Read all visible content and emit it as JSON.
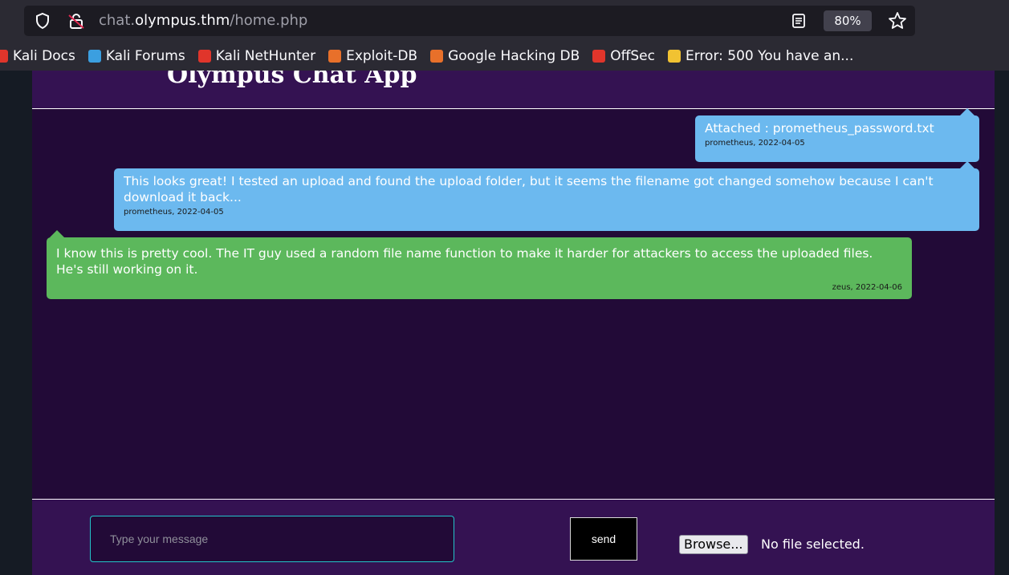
{
  "browser": {
    "url_prefix": "chat.",
    "url_host": "olympus.thm",
    "url_path": "/home.php",
    "zoom": "80%"
  },
  "bookmarks": [
    {
      "label": "Kali Docs",
      "icon": "kali-docs-icon",
      "color": "#e0352b"
    },
    {
      "label": "Kali Forums",
      "icon": "kali-forums-icon",
      "color": "#3b9fe0"
    },
    {
      "label": "Kali NetHunter",
      "icon": "kali-nethunter-icon",
      "color": "#e0352b"
    },
    {
      "label": "Exploit-DB",
      "icon": "exploit-db-icon",
      "color": "#e8702a"
    },
    {
      "label": "Google Hacking DB",
      "icon": "google-hacking-db-icon",
      "color": "#e8702a"
    },
    {
      "label": "OffSec",
      "icon": "offsec-icon",
      "color": "#e0352b"
    },
    {
      "label": "Error: 500 You have an...",
      "icon": "error-page-icon",
      "color": "#f1c232"
    }
  ],
  "app": {
    "title": "Olympus Chat App"
  },
  "messages": [
    {
      "text": "Attached : prometheus_password.txt",
      "meta": "prometheus, 2022-04-05",
      "style": "blue"
    },
    {
      "text": "This looks great! I tested an upload and found the upload folder, but it seems the filename got changed somehow because I can't download it back...",
      "meta": "prometheus, 2022-04-05",
      "style": "blue"
    },
    {
      "text": "I know this is pretty cool. The IT guy used a random file name function to make it harder for attackers to access the uploaded files. He's still working on it.",
      "meta": "zeus, 2022-04-06",
      "style": "green"
    }
  ],
  "composer": {
    "placeholder": "Type your message",
    "send_label": "send",
    "browse_label": "Browse...",
    "file_status": "No file selected."
  },
  "colors": {
    "page_bg": "#220a37",
    "header_bg": "#341252",
    "blue_bubble": "#6cb9ef",
    "green_bubble": "#5cb85c",
    "input_border": "#23c4c9"
  }
}
